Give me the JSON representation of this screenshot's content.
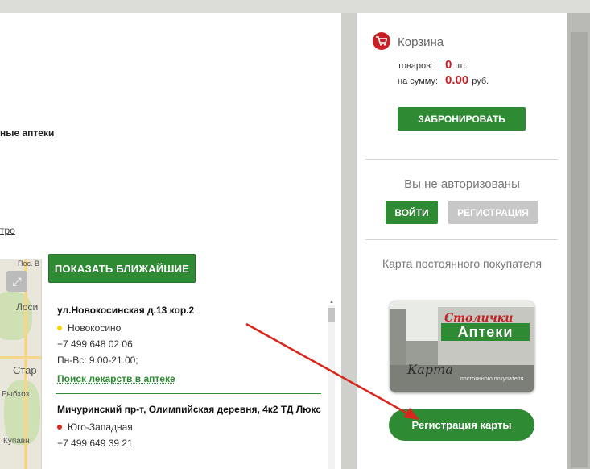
{
  "left": {
    "fragment_top": "ные аптеки",
    "fragment_link": "тро",
    "map_labels": [
      "Пос. В",
      "Лоси",
      "Стар",
      "Рыбхоз",
      "Купавн"
    ],
    "nearest_button": "ПОКАЗАТЬ БЛИЖАЙШИЕ",
    "pharmacies": [
      {
        "address": "ул.Новокосинская д.13 кор.2",
        "metro": "Новокосино",
        "metro_color": "#f5d400",
        "phone": "+7 499 648 02 06",
        "hours": "Пн-Вс: 9.00-21.00;",
        "search_link": "Поиск лекарств в аптеке"
      },
      {
        "address": "Мичуринский пр-т, Олимпийская деревня, 4к2 ТД Люкс",
        "metro": "Юго-Западная",
        "metro_color": "#d52a1f",
        "phone": "+7 499 649 39 21"
      }
    ]
  },
  "cart": {
    "title": "Корзина",
    "items_label": "товаров:",
    "items_count": "0",
    "items_unit": "шт.",
    "sum_label": "на сумму:",
    "sum_value": "0.00",
    "sum_unit": "руб.",
    "reserve_button": "ЗАБРОНИРОВАТЬ"
  },
  "auth": {
    "status": "Вы не авторизованы",
    "login_button": "ВОЙТИ",
    "register_button": "РЕГИСТРАЦИЯ"
  },
  "loyalty": {
    "title": "Карта постоянного покупателя",
    "card_logo_script": "Столички",
    "card_logo_main": "Аптеки",
    "card_script": "Карта",
    "card_small": "постоянного покупателя",
    "register_card_button": "Регистрация карты"
  },
  "colors": {
    "brand_green": "#2f8a34",
    "accent_red": "#c81f24",
    "arrow_red": "#d9261c"
  }
}
